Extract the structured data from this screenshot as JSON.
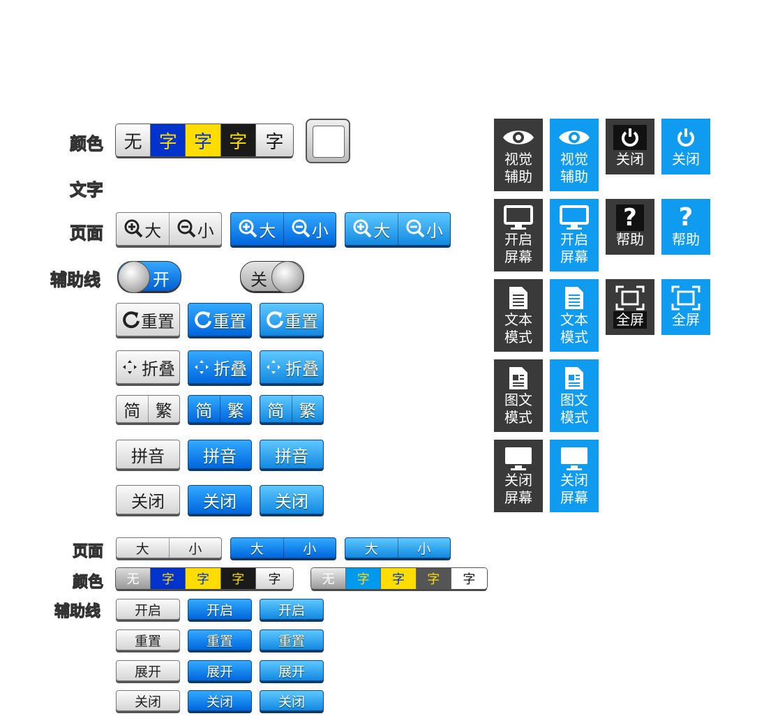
{
  "labels": {
    "color": "颜色",
    "text": "文字",
    "page": "页面",
    "guide": "辅助线",
    "page2": "页面",
    "color2": "颜色",
    "guide2": "辅助线"
  },
  "color_swatches": [
    "无",
    "字",
    "字",
    "字",
    "字"
  ],
  "zoom": {
    "big": "大",
    "small": "小"
  },
  "toggle": {
    "on": "开",
    "off": "关"
  },
  "buttons": {
    "reset": "重置",
    "fold": "折叠",
    "simp": "简",
    "trad": "繁",
    "pinyin": "拼音",
    "close": "关闭"
  },
  "small_buttons": {
    "open": "开启",
    "reset": "重置",
    "expand": "展开",
    "close": "关闭"
  },
  "tiles": {
    "visual_aid": [
      "视觉",
      "辅助"
    ],
    "close": "关闭",
    "open_screen": [
      "开启",
      "屏幕"
    ],
    "help": "帮助",
    "text_mode": [
      "文本",
      "模式"
    ],
    "fullscreen": "全屏",
    "image_mode": [
      "图文",
      "模式"
    ],
    "close_screen": [
      "关闭",
      "屏幕"
    ]
  },
  "colors": {
    "blue": "#0f9bf0",
    "dark": "#3a3a3a",
    "swatch_blue": "#0033cc",
    "swatch_yellow": "#ffdd00",
    "swatch_black": "#1a1a1a"
  }
}
